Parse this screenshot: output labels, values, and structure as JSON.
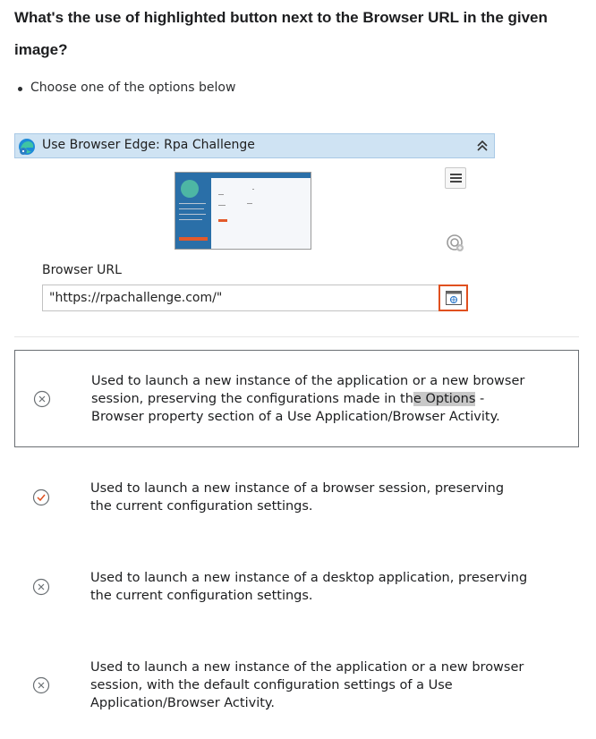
{
  "question": "What's the use of highlighted button next to the Browser URL in the given image?",
  "instruction": "Choose one of the options below",
  "activity": {
    "title": "Use Browser Edge: Rpa Challenge",
    "url_label": "Browser URL",
    "url_value": "\"https://rpachallenge.com/\""
  },
  "options": [
    {
      "text_before": "Used to launch a new instance of the application or a new browser session, preserving the configurations made in th",
      "text_highlight": "e Options",
      "text_after": " - Browser property section of a Use Application/Browser Activity.",
      "state": "incorrect",
      "selected": true
    },
    {
      "text": "Used to launch a new instance of a browser session, preserving the current configuration settings.",
      "state": "correct",
      "selected": false
    },
    {
      "text": "Used to launch a new instance of a desktop application, preserving the current configuration settings.",
      "state": "incorrect",
      "selected": false
    },
    {
      "text": "Used to launch a new instance of the application or a new browser session, with the default configuration settings of a Use Application/Browser Activity.",
      "state": "incorrect",
      "selected": false
    }
  ],
  "icons": {
    "correct": "check-circle-icon",
    "incorrect": "x-circle-icon"
  },
  "colors": {
    "highlight_border": "#e0501f",
    "header_bg": "#cfe3f3",
    "correct": "#e0501f"
  }
}
